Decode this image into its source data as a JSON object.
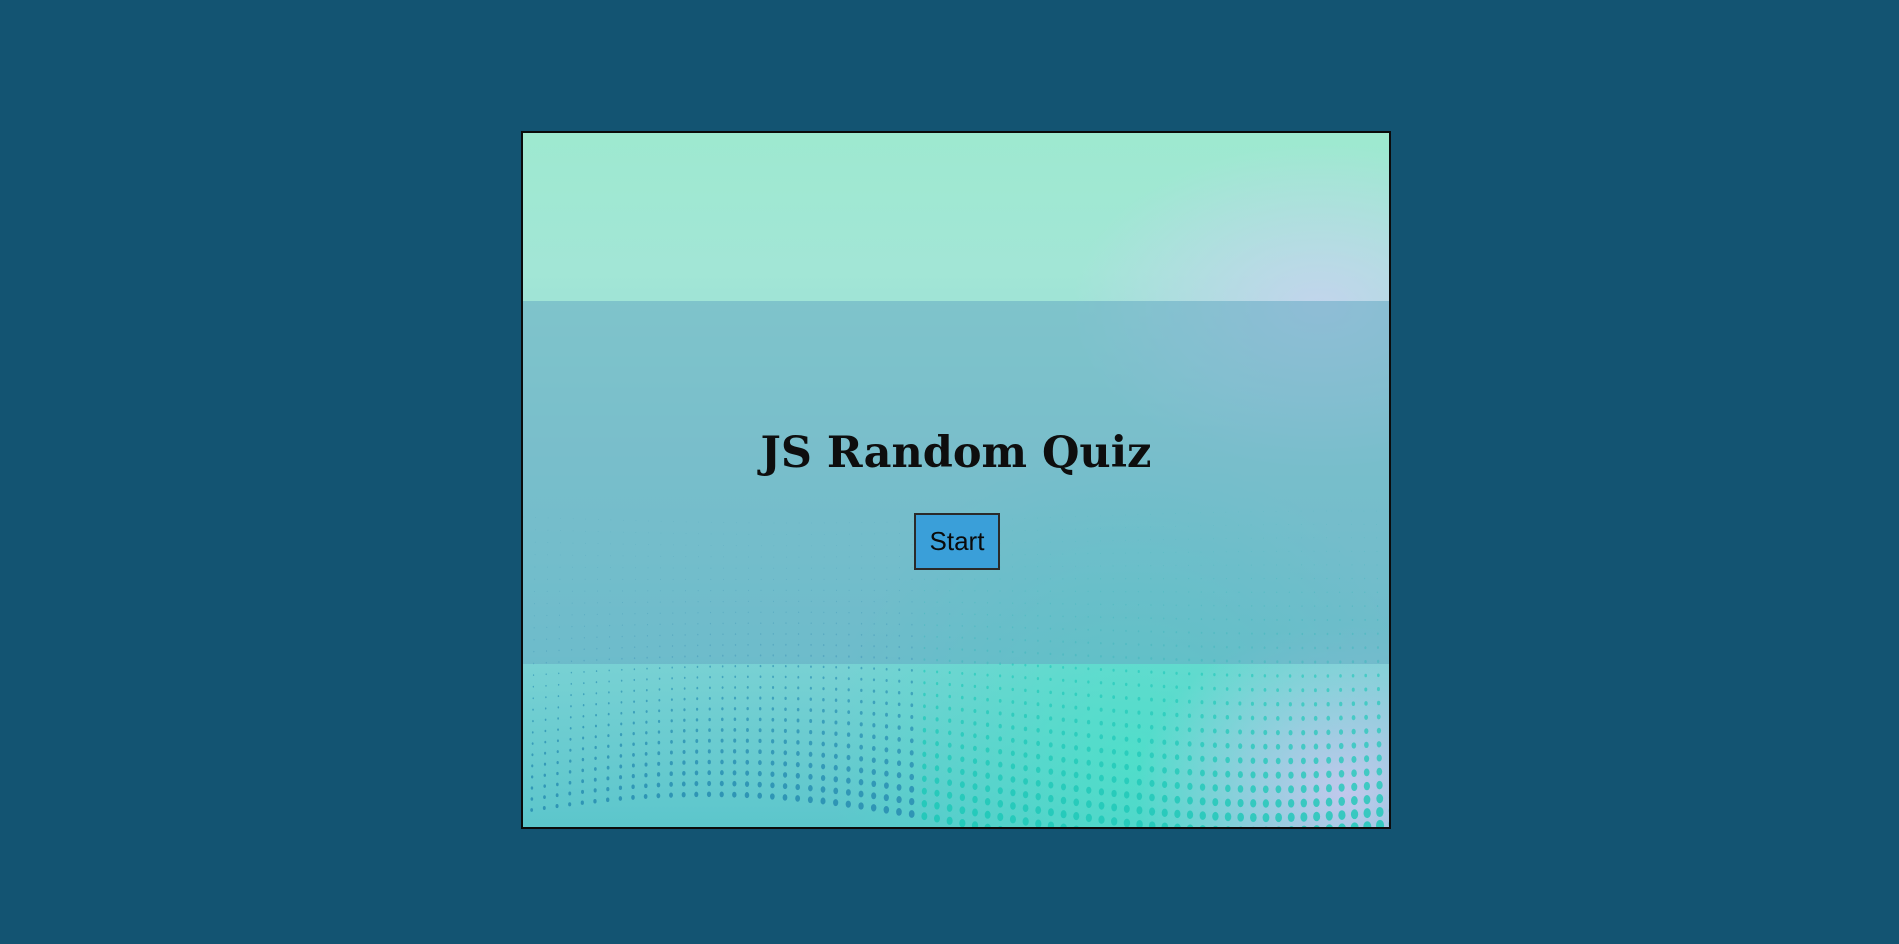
{
  "quiz": {
    "title": "JS Random Quiz",
    "start_label": "Start"
  },
  "colors": {
    "page_background": "#135472",
    "button_background": "#3a9fd9",
    "frame_border": "#0b0b0b"
  }
}
